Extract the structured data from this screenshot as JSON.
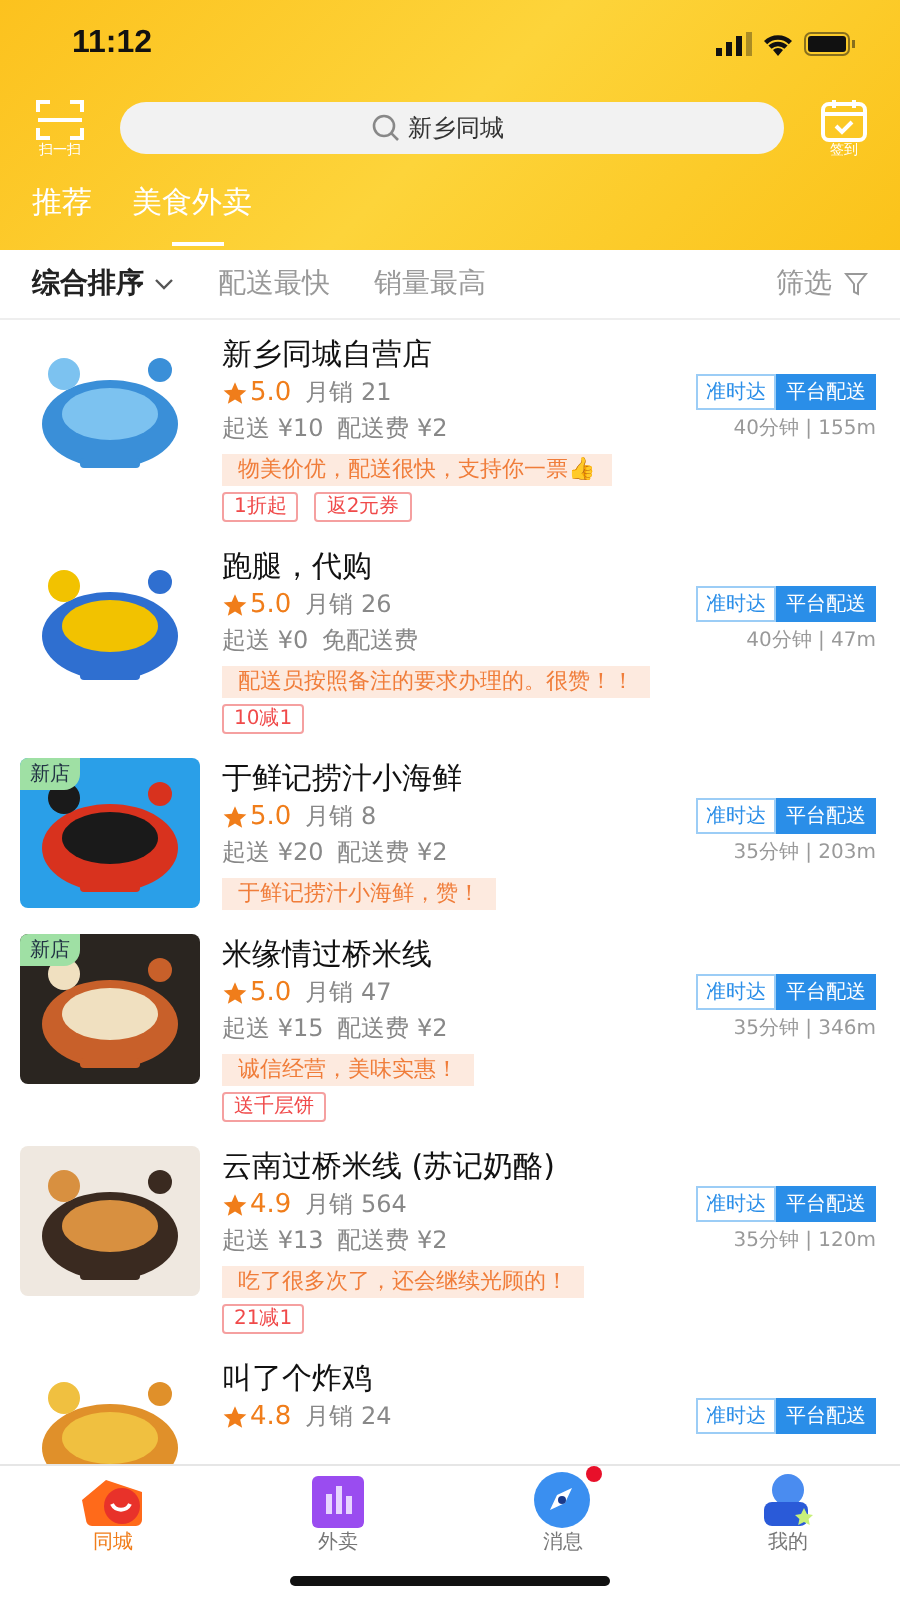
{
  "status_bar": {
    "time": "11:12"
  },
  "header": {
    "scan_label": "扫一扫",
    "search": {
      "placeholder": "新乡同城"
    },
    "checkin_label": "签到"
  },
  "tabs": [
    {
      "label": "推荐",
      "selected": false
    },
    {
      "label": "美食外卖",
      "selected": true
    }
  ],
  "sort_bar": {
    "options": [
      {
        "label": "综合排序",
        "selected": true,
        "dropdown": true
      },
      {
        "label": "配送最快",
        "selected": false,
        "dropdown": false
      },
      {
        "label": "销量最高",
        "selected": false,
        "dropdown": false
      }
    ],
    "filter_label": "筛选"
  },
  "shops": [
    {
      "name": "新乡同城自营店",
      "new_store": false,
      "rating": "5.0",
      "sales": "月销 21",
      "min_order": "起送 ¥10",
      "delivery_fee": "配送费 ¥2",
      "time_distance": "40分钟 | 155m",
      "review": "物美价优，配送很快，支持你一票👍",
      "coupons": [
        "1折起",
        "返2元券"
      ],
      "tags": [
        {
          "label": "准时达",
          "kind": "outline"
        },
        {
          "label": "平台配送",
          "kind": "filled"
        }
      ]
    },
    {
      "name": "跑腿，代购",
      "new_store": false,
      "rating": "5.0",
      "sales": "月销 26",
      "min_order": "起送 ¥0",
      "delivery_fee": "免配送费",
      "time_distance": "40分钟 | 47m",
      "review": "配送员按照备注的要求办理的。很赞！！",
      "coupons": [
        "10减1"
      ],
      "tags": [
        {
          "label": "准时达",
          "kind": "outline"
        },
        {
          "label": "平台配送",
          "kind": "filled"
        }
      ]
    },
    {
      "name": "于鲜记捞汁小海鲜",
      "new_store": true,
      "new_label": "新店",
      "rating": "5.0",
      "sales": "月销 8",
      "min_order": "起送 ¥20",
      "delivery_fee": "配送费 ¥2",
      "time_distance": "35分钟 | 203m",
      "review": "于鲜记捞汁小海鲜，赞！",
      "tags": [
        {
          "label": "准时达",
          "kind": "outline"
        },
        {
          "label": "平台配送",
          "kind": "filled"
        }
      ]
    },
    {
      "name": "米缘情过桥米线",
      "new_store": true,
      "new_label": "新店",
      "rating": "5.0",
      "sales": "月销 47",
      "min_order": "起送 ¥15",
      "delivery_fee": "配送费 ¥2",
      "time_distance": "35分钟 | 346m",
      "review": "诚信经营，美味实惠！",
      "coupons": [
        "送千层饼"
      ],
      "tags": [
        {
          "label": "准时达",
          "kind": "outline"
        },
        {
          "label": "平台配送",
          "kind": "filled"
        }
      ]
    },
    {
      "name": "云南过桥米线 (苏记奶酪)",
      "new_store": false,
      "rating": "4.9",
      "sales": "月销 564",
      "min_order": "起送 ¥13",
      "delivery_fee": "配送费 ¥2",
      "time_distance": "35分钟 | 120m",
      "review": "吃了很多次了，还会继续光顾的！",
      "coupons": [
        "21减1"
      ],
      "tags": [
        {
          "label": "准时达",
          "kind": "outline"
        },
        {
          "label": "平台配送",
          "kind": "filled"
        }
      ]
    },
    {
      "name": "叫了个炸鸡",
      "new_store": false,
      "rating": "4.8",
      "sales": "月销 24",
      "tags": [
        {
          "label": "准时达",
          "kind": "outline"
        },
        {
          "label": "平台配送",
          "kind": "filled"
        }
      ]
    }
  ],
  "bottom_nav": [
    {
      "label": "同城",
      "selected": true,
      "badge": false
    },
    {
      "label": "外卖",
      "selected": false,
      "badge": false
    },
    {
      "label": "消息",
      "selected": false,
      "badge": true
    },
    {
      "label": "我的",
      "selected": false,
      "badge": false
    }
  ]
}
